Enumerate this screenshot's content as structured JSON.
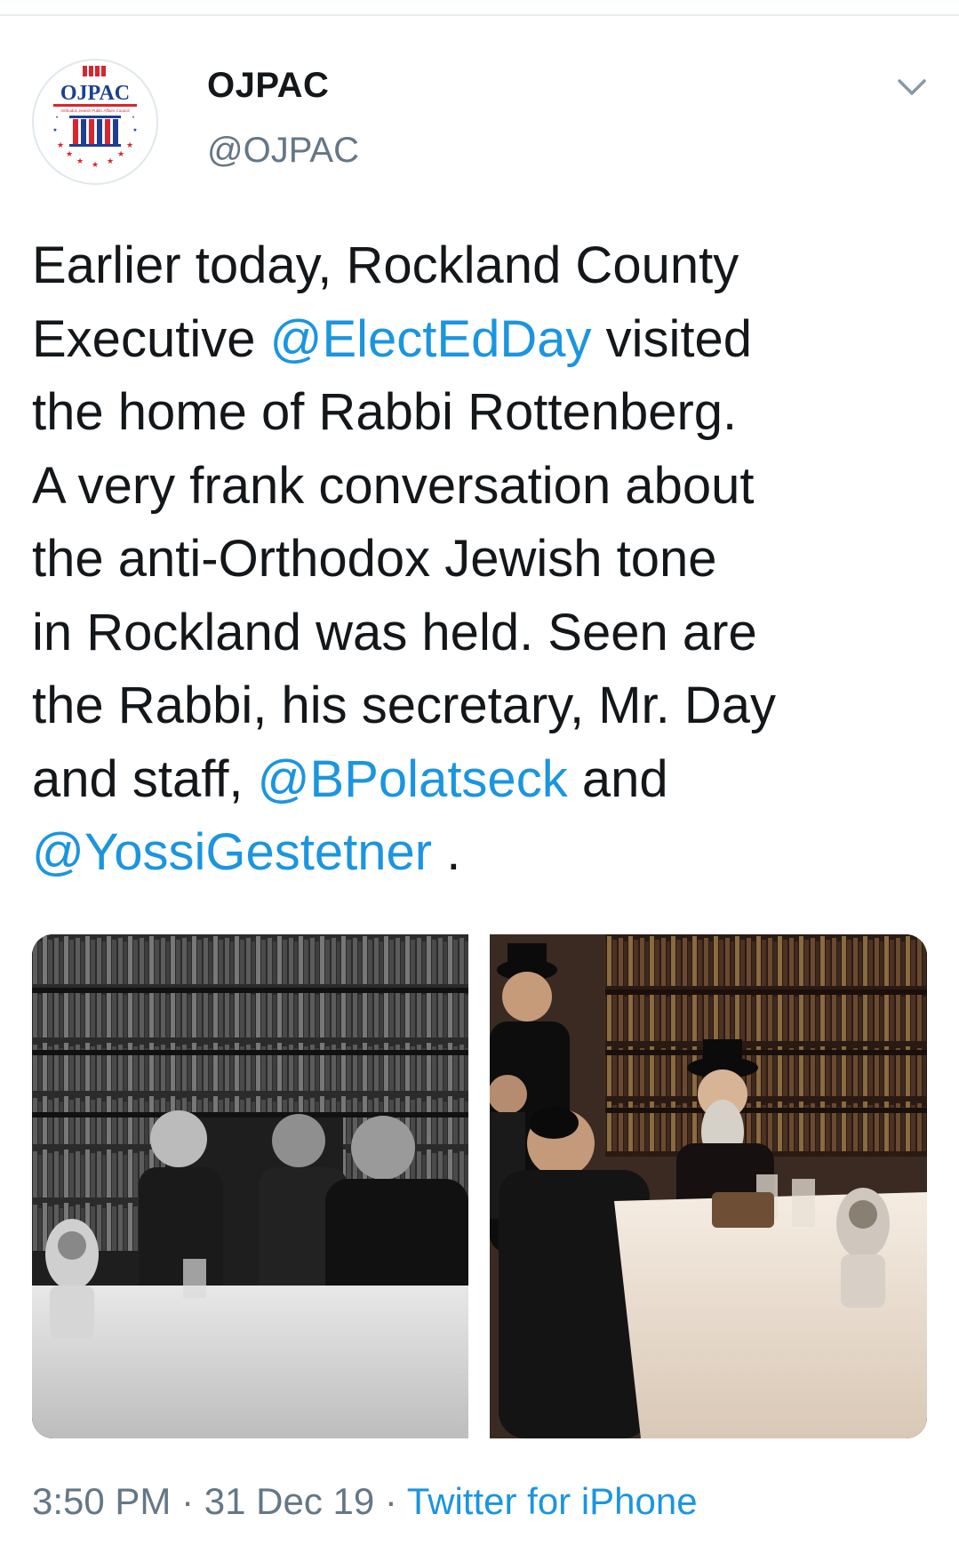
{
  "tweet": {
    "author": {
      "display_name": "OJPAC",
      "handle": "@OJPAC",
      "avatar": {
        "logo_text": "OJPAC",
        "logo_subtext": "Orthodox Jewish Public Affairs Council",
        "colors": {
          "red": "#d7262d",
          "blue": "#1c3f94",
          "white": "#ffffff"
        }
      }
    },
    "menu_icon": "chevron-down-icon",
    "text": {
      "line1": "Earlier today, Rockland County",
      "line2_pre": "Executive ",
      "mention1": "@ElectEdDay",
      "line2_post": " visited",
      "line3": "the home of Rabbi Rottenberg.",
      "line4": "A very frank conversation about",
      "line5": "the anti-Orthodox Jewish tone",
      "line6": "in Rockland was held. Seen are",
      "line7": "the Rabbi, his secretary, Mr. Day",
      "line8_pre": "and staff, ",
      "mention2": "@BPolatseck",
      "line8_post": " and",
      "mention3": "@YossiGestetner",
      "line9_post": " ."
    },
    "media": [
      {
        "kind": "photo",
        "style": "black-and-white",
        "scene": "meeting at table in library"
      },
      {
        "kind": "photo",
        "style": "color",
        "scene": "meeting with rabbi at table in library"
      }
    ],
    "meta": {
      "time": "3:50 PM",
      "separator": " · ",
      "date": "31 Dec 19",
      "source": "Twitter for iPhone"
    },
    "colors": {
      "text": "#14171a",
      "secondary": "#657786",
      "link": "#1b95e0",
      "divider": "#e6ecf0"
    }
  }
}
